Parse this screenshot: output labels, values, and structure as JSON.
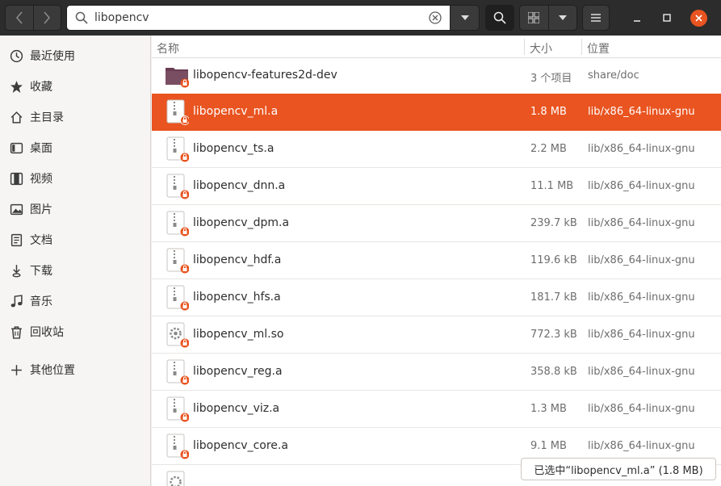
{
  "toolbar": {
    "back_icon": "chevron-left-icon",
    "forward_icon": "chevron-right-icon",
    "search_value": "libopencv",
    "search_icon": "search-icon",
    "clear_icon": "clear-icon",
    "search_dropdown_icon": "triangle-down-icon",
    "search_toggle_icon": "search-icon",
    "grid_view_icon": "grid-icon",
    "view_options_icon": "triangle-down-icon",
    "menu_icon": "hamburger-icon",
    "minimize_icon": "minimize-icon",
    "maximize_icon": "maximize-icon",
    "close_icon": "close-icon"
  },
  "colors": {
    "accent": "#e95420",
    "headerbar": "#2c2c2c",
    "sidebar_bg": "#f6f5f4"
  },
  "sidebar": {
    "items": [
      {
        "label": "最近使用",
        "icon": "clock-icon"
      },
      {
        "label": "收藏",
        "icon": "star-icon"
      },
      {
        "label": "主目录",
        "icon": "home-icon"
      },
      {
        "label": "桌面",
        "icon": "desktop-icon"
      },
      {
        "label": "视频",
        "icon": "film-icon"
      },
      {
        "label": "图片",
        "icon": "image-icon"
      },
      {
        "label": "文档",
        "icon": "document-icon"
      },
      {
        "label": "下载",
        "icon": "download-icon"
      },
      {
        "label": "音乐",
        "icon": "music-icon"
      },
      {
        "label": "回收站",
        "icon": "trash-icon"
      },
      {
        "label": "其他位置",
        "icon": "plus-icon"
      }
    ]
  },
  "columns": {
    "name": "名称",
    "size": "大小",
    "location": "位置"
  },
  "files": [
    {
      "name": "libopencv-features2d-dev",
      "size": "3 个项目",
      "location": "share/doc",
      "icon": "folder-icon",
      "selected": false
    },
    {
      "name": "libopencv_ml.a",
      "size": "1.8 MB",
      "location": "lib/x86_64-linux-gnu",
      "icon": "archive-icon",
      "selected": true
    },
    {
      "name": "libopencv_ts.a",
      "size": "2.2 MB",
      "location": "lib/x86_64-linux-gnu",
      "icon": "archive-icon",
      "selected": false
    },
    {
      "name": "libopencv_dnn.a",
      "size": "11.1 MB",
      "location": "lib/x86_64-linux-gnu",
      "icon": "archive-icon",
      "selected": false
    },
    {
      "name": "libopencv_dpm.a",
      "size": "239.7 kB",
      "location": "lib/x86_64-linux-gnu",
      "icon": "archive-icon",
      "selected": false
    },
    {
      "name": "libopencv_hdf.a",
      "size": "119.6 kB",
      "location": "lib/x86_64-linux-gnu",
      "icon": "archive-icon",
      "selected": false
    },
    {
      "name": "libopencv_hfs.a",
      "size": "181.7 kB",
      "location": "lib/x86_64-linux-gnu",
      "icon": "archive-icon",
      "selected": false
    },
    {
      "name": "libopencv_ml.so",
      "size": "772.3 kB",
      "location": "lib/x86_64-linux-gnu",
      "icon": "shared-library-icon",
      "selected": false
    },
    {
      "name": "libopencv_reg.a",
      "size": "358.8 kB",
      "location": "lib/x86_64-linux-gnu",
      "icon": "archive-icon",
      "selected": false
    },
    {
      "name": "libopencv_viz.a",
      "size": "1.3 MB",
      "location": "lib/x86_64-linux-gnu",
      "icon": "archive-icon",
      "selected": false
    },
    {
      "name": "libopencv_core.a",
      "size": "9.1 MB",
      "location": "lib/x86_64-linux-gnu",
      "icon": "archive-icon",
      "selected": false
    }
  ],
  "status": {
    "selection_text": "已选中“libopencv_ml.a” (1.8 MB)"
  }
}
